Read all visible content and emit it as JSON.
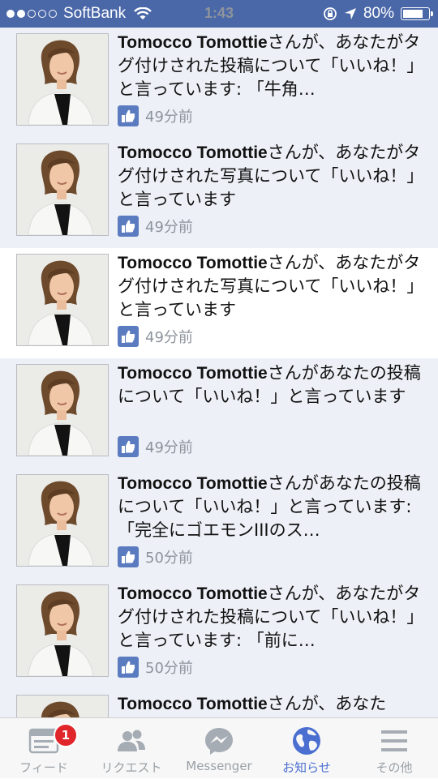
{
  "status_bar": {
    "carrier": "SoftBank",
    "time": "1:43",
    "battery": "80%",
    "battery_level": 0.8
  },
  "notifications": [
    {
      "name": "Tomocco Tomottie",
      "message": "さんが、あなたがタグ付けされた投稿について「いいね！」と言っています: 「牛角…",
      "time": "49分前",
      "read": false
    },
    {
      "name": "Tomocco Tomottie",
      "message": "さんが、あなたがタグ付けされた写真について「いいね！」と言っています",
      "time": "49分前",
      "read": false
    },
    {
      "name": "Tomocco Tomottie",
      "message": "さんが、あなたがタグ付けされた写真について「いいね！」と言っています",
      "time": "49分前",
      "read": true
    },
    {
      "name": "Tomocco Tomottie",
      "message": "さんがあなたの投稿について「いいね！」と言っています",
      "time": "49分前",
      "read": false
    },
    {
      "name": "Tomocco Tomottie",
      "message": "さんがあなたの投稿について「いいね！」と言っています: 「完全にゴエモンIIIのス…",
      "time": "50分前",
      "read": false
    },
    {
      "name": "Tomocco Tomottie",
      "message": "さんが、あなたがタグ付けされた投稿について「いいね！」と言っています: 「前に…",
      "time": "50分前",
      "read": false
    },
    {
      "name": "Tomocco Tomottie",
      "message": "さんが、あなた",
      "time": "",
      "read": false
    }
  ],
  "tab_bar": {
    "tabs": [
      {
        "label": "フィード",
        "icon": "feed-icon",
        "badge": "1"
      },
      {
        "label": "リクエスト",
        "icon": "friend-requests-icon"
      },
      {
        "label": "Messenger",
        "icon": "messenger-icon"
      },
      {
        "label": "お知らせ",
        "icon": "globe-icon",
        "active": true
      },
      {
        "label": "その他",
        "icon": "menu-icon"
      }
    ]
  },
  "colors": {
    "brand": "#4a67a8",
    "unread_bg": "#edf0f6",
    "active_tab": "#4a6fd0",
    "badge": "#e0262b"
  }
}
